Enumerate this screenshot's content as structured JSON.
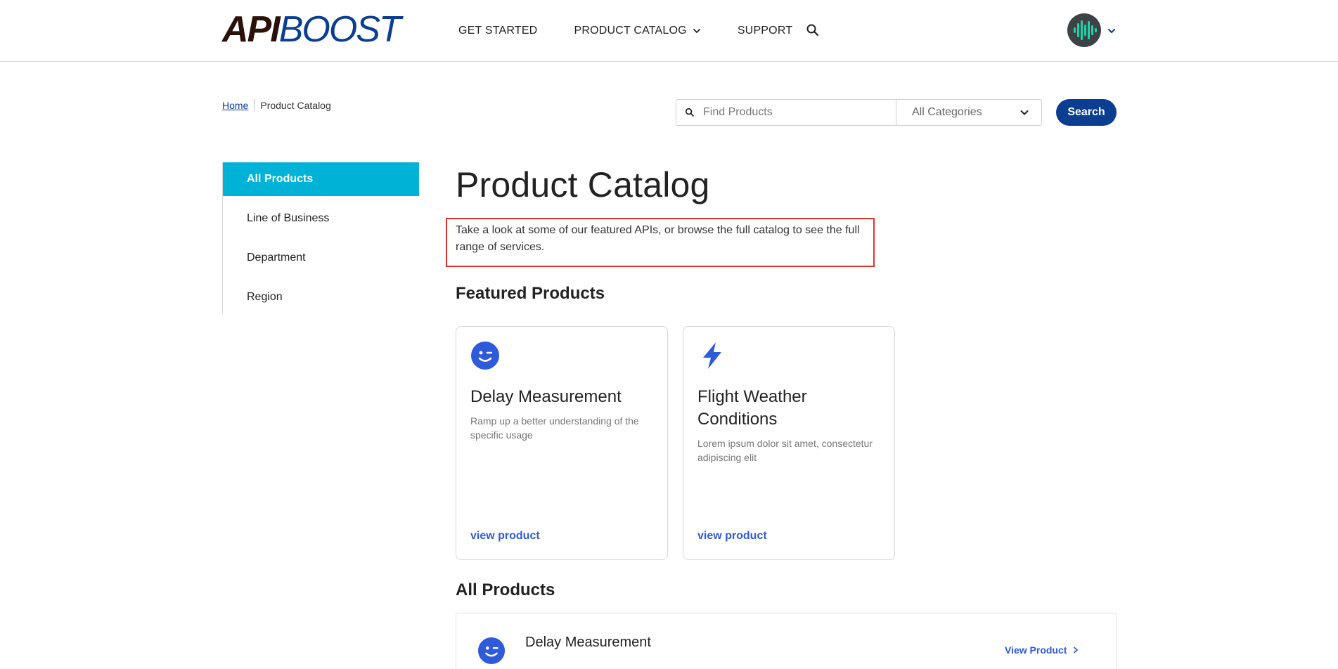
{
  "header": {
    "logo_part1": "API",
    "logo_part2": "BOOST",
    "nav": {
      "get_started": "GET STARTED",
      "product_catalog": "PRODUCT CATALOG",
      "support": "SUPPORT"
    },
    "icons": {
      "search": "search-icon",
      "nav_chevron": "chevron-down-icon",
      "avatar": "avatar-waveform",
      "avatar_chevron": "chevron-down-icon"
    }
  },
  "breadcrumb": {
    "home": "Home",
    "current": "Product Catalog"
  },
  "search": {
    "placeholder": "Find Products",
    "value": "",
    "category": "All Categories",
    "button_label": "Search"
  },
  "sidebar": {
    "items": [
      {
        "label": "All Products",
        "active": true
      },
      {
        "label": "Line of Business",
        "active": false
      },
      {
        "label": "Department",
        "active": false
      },
      {
        "label": "Region",
        "active": false
      }
    ]
  },
  "main": {
    "title": "Product Catalog",
    "intro": "Take a look at some of our featured APIs, or browse the full catalog to see the full range of services.",
    "featured_title": "Featured Products",
    "featured": [
      {
        "icon": "wink-face-icon",
        "title": "Delay Measurement",
        "description": "Ramp up a better understanding of the specific usage",
        "link": "view product"
      },
      {
        "icon": "lightning-bolt-icon",
        "title": "Flight Weather Conditions",
        "description": "Lorem ipsum dolor sit amet, consectetur adipiscing elit",
        "link": "view product"
      }
    ],
    "all_products_title": "All Products",
    "all_products": [
      {
        "icon": "wink-face-icon",
        "title": "Delay Measurement",
        "link": "View Product"
      }
    ]
  },
  "colors": {
    "brand_dark": "#2a1209",
    "brand_blue": "#0b3d91",
    "accent_cyan": "#00b2d6",
    "link_blue": "#2f5ad8",
    "highlight_red": "#e03131"
  }
}
